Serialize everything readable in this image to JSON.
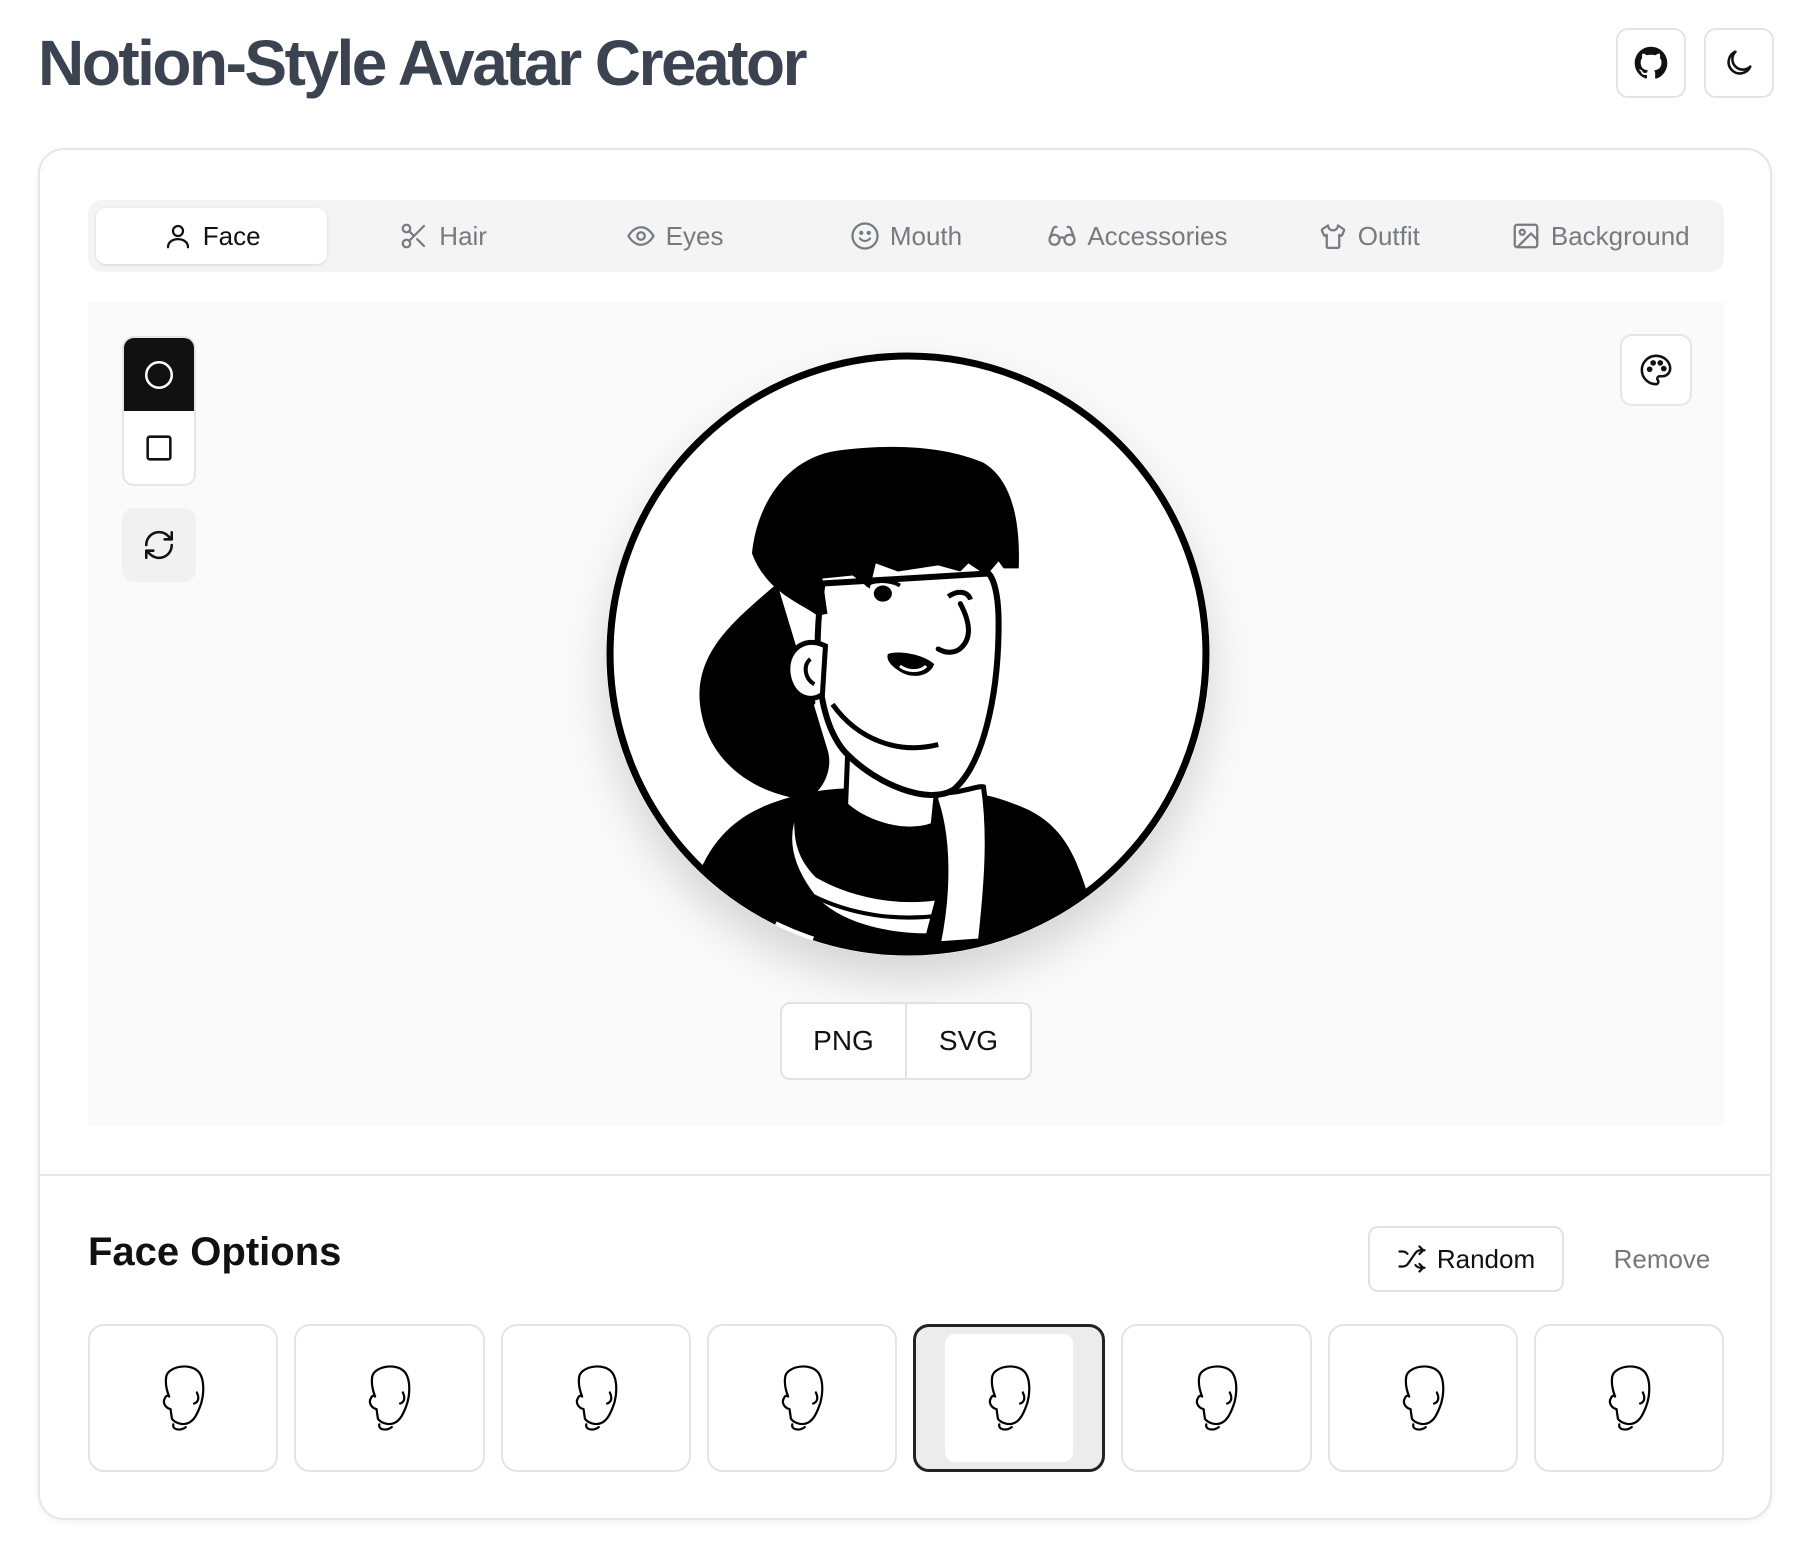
{
  "header": {
    "title": "Notion-Style Avatar Creator",
    "github_icon": "github-icon",
    "theme_icon": "moon-icon"
  },
  "tabs": [
    {
      "label": "Face",
      "icon": "user-icon",
      "active": true
    },
    {
      "label": "Hair",
      "icon": "scissors-icon",
      "active": false
    },
    {
      "label": "Eyes",
      "icon": "eye-icon",
      "active": false
    },
    {
      "label": "Mouth",
      "icon": "smile-icon",
      "active": false
    },
    {
      "label": "Accessories",
      "icon": "glasses-icon",
      "active": false
    },
    {
      "label": "Outfit",
      "icon": "shirt-icon",
      "active": false
    },
    {
      "label": "Background",
      "icon": "image-icon",
      "active": false
    }
  ],
  "preview": {
    "shape_options": [
      "circle",
      "square"
    ],
    "selected_shape": "circle",
    "export_png": "PNG",
    "export_svg": "SVG"
  },
  "options_panel": {
    "title": "Face Options",
    "random_label": "Random",
    "remove_label": "Remove",
    "option_count": 8,
    "selected_index": 4
  },
  "colors": {
    "title": "#3b4351",
    "accent": "#111111",
    "muted": "#777a80"
  }
}
